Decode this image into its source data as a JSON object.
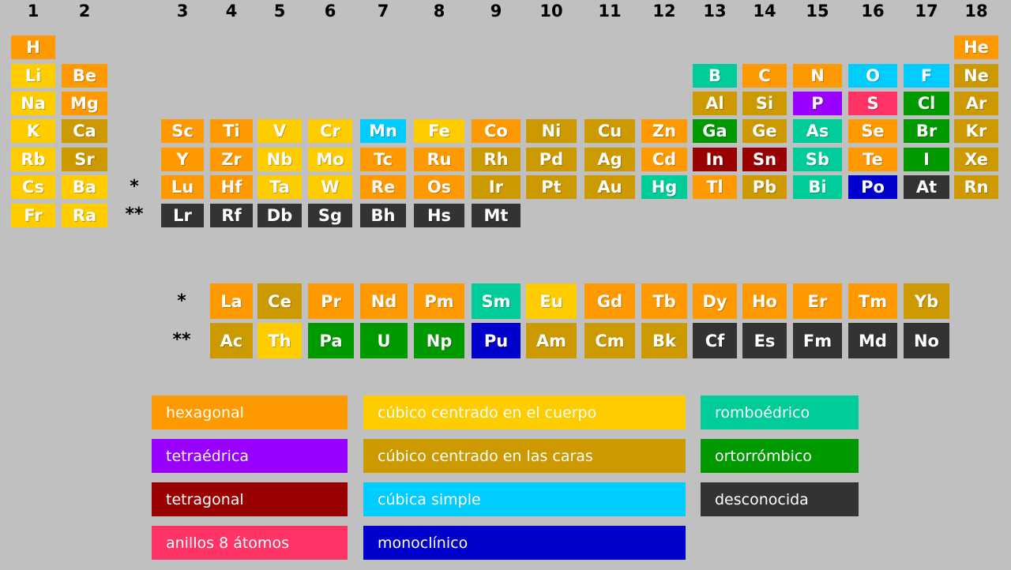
{
  "colors": {
    "hexagonal": "#ff9900",
    "bcc": "#ffcc00",
    "fcc": "#cc9900",
    "rhombo": "#00cc99",
    "ortho": "#009900",
    "tetragonal": "#990000",
    "tetrahedral": "#9900ff",
    "cubic_simple": "#00ccff",
    "mono": "#0000cc",
    "s8": "#ff3366",
    "unknown": "#333333"
  },
  "groups": [
    "1",
    "2",
    "3",
    "4",
    "5",
    "6",
    "7",
    "8",
    "9",
    "10",
    "11",
    "12",
    "13",
    "14",
    "15",
    "16",
    "17",
    "18"
  ],
  "markers": {
    "lanthanide": "*",
    "actinide": "**"
  },
  "elements": [
    {
      "symbol": "H",
      "row": 1,
      "group": 1,
      "structure": "hexagonal"
    },
    {
      "symbol": "He",
      "row": 1,
      "group": 18,
      "structure": "hexagonal"
    },
    {
      "symbol": "Li",
      "row": 2,
      "group": 1,
      "structure": "bcc"
    },
    {
      "symbol": "Be",
      "row": 2,
      "group": 2,
      "structure": "hexagonal"
    },
    {
      "symbol": "B",
      "row": 2,
      "group": 13,
      "structure": "rhombo"
    },
    {
      "symbol": "C",
      "row": 2,
      "group": 14,
      "structure": "hexagonal"
    },
    {
      "symbol": "N",
      "row": 2,
      "group": 15,
      "structure": "hexagonal"
    },
    {
      "symbol": "O",
      "row": 2,
      "group": 16,
      "structure": "cubic_simple"
    },
    {
      "symbol": "F",
      "row": 2,
      "group": 17,
      "structure": "cubic_simple"
    },
    {
      "symbol": "Ne",
      "row": 2,
      "group": 18,
      "structure": "fcc"
    },
    {
      "symbol": "Na",
      "row": 3,
      "group": 1,
      "structure": "bcc"
    },
    {
      "symbol": "Mg",
      "row": 3,
      "group": 2,
      "structure": "hexagonal"
    },
    {
      "symbol": "Al",
      "row": 3,
      "group": 13,
      "structure": "fcc"
    },
    {
      "symbol": "Si",
      "row": 3,
      "group": 14,
      "structure": "fcc"
    },
    {
      "symbol": "P",
      "row": 3,
      "group": 15,
      "structure": "tetrahedral"
    },
    {
      "symbol": "S",
      "row": 3,
      "group": 16,
      "structure": "s8"
    },
    {
      "symbol": "Cl",
      "row": 3,
      "group": 17,
      "structure": "ortho"
    },
    {
      "symbol": "Ar",
      "row": 3,
      "group": 18,
      "structure": "fcc"
    },
    {
      "symbol": "K",
      "row": 4,
      "group": 1,
      "structure": "bcc"
    },
    {
      "symbol": "Ca",
      "row": 4,
      "group": 2,
      "structure": "fcc"
    },
    {
      "symbol": "Sc",
      "row": 4,
      "group": 3,
      "structure": "hexagonal"
    },
    {
      "symbol": "Ti",
      "row": 4,
      "group": 4,
      "structure": "hexagonal"
    },
    {
      "symbol": "V",
      "row": 4,
      "group": 5,
      "structure": "bcc"
    },
    {
      "symbol": "Cr",
      "row": 4,
      "group": 6,
      "structure": "bcc"
    },
    {
      "symbol": "Mn",
      "row": 4,
      "group": 7,
      "structure": "cubic_simple"
    },
    {
      "symbol": "Fe",
      "row": 4,
      "group": 8,
      "structure": "bcc"
    },
    {
      "symbol": "Co",
      "row": 4,
      "group": 9,
      "structure": "hexagonal"
    },
    {
      "symbol": "Ni",
      "row": 4,
      "group": 10,
      "structure": "fcc"
    },
    {
      "symbol": "Cu",
      "row": 4,
      "group": 11,
      "structure": "fcc"
    },
    {
      "symbol": "Zn",
      "row": 4,
      "group": 12,
      "structure": "hexagonal"
    },
    {
      "symbol": "Ga",
      "row": 4,
      "group": 13,
      "structure": "ortho"
    },
    {
      "symbol": "Ge",
      "row": 4,
      "group": 14,
      "structure": "fcc"
    },
    {
      "symbol": "As",
      "row": 4,
      "group": 15,
      "structure": "rhombo"
    },
    {
      "symbol": "Se",
      "row": 4,
      "group": 16,
      "structure": "hexagonal"
    },
    {
      "symbol": "Br",
      "row": 4,
      "group": 17,
      "structure": "ortho"
    },
    {
      "symbol": "Kr",
      "row": 4,
      "group": 18,
      "structure": "fcc"
    },
    {
      "symbol": "Rb",
      "row": 5,
      "group": 1,
      "structure": "bcc"
    },
    {
      "symbol": "Sr",
      "row": 5,
      "group": 2,
      "structure": "fcc"
    },
    {
      "symbol": "Y",
      "row": 5,
      "group": 3,
      "structure": "hexagonal"
    },
    {
      "symbol": "Zr",
      "row": 5,
      "group": 4,
      "structure": "hexagonal"
    },
    {
      "symbol": "Nb",
      "row": 5,
      "group": 5,
      "structure": "bcc"
    },
    {
      "symbol": "Mo",
      "row": 5,
      "group": 6,
      "structure": "bcc"
    },
    {
      "symbol": "Tc",
      "row": 5,
      "group": 7,
      "structure": "hexagonal"
    },
    {
      "symbol": "Ru",
      "row": 5,
      "group": 8,
      "structure": "hexagonal"
    },
    {
      "symbol": "Rh",
      "row": 5,
      "group": 9,
      "structure": "fcc"
    },
    {
      "symbol": "Pd",
      "row": 5,
      "group": 10,
      "structure": "fcc"
    },
    {
      "symbol": "Ag",
      "row": 5,
      "group": 11,
      "structure": "fcc"
    },
    {
      "symbol": "Cd",
      "row": 5,
      "group": 12,
      "structure": "hexagonal"
    },
    {
      "symbol": "In",
      "row": 5,
      "group": 13,
      "structure": "tetragonal"
    },
    {
      "symbol": "Sn",
      "row": 5,
      "group": 14,
      "structure": "tetragonal"
    },
    {
      "symbol": "Sb",
      "row": 5,
      "group": 15,
      "structure": "rhombo"
    },
    {
      "symbol": "Te",
      "row": 5,
      "group": 16,
      "structure": "hexagonal"
    },
    {
      "symbol": "I",
      "row": 5,
      "group": 17,
      "structure": "ortho"
    },
    {
      "symbol": "Xe",
      "row": 5,
      "group": 18,
      "structure": "fcc"
    },
    {
      "symbol": "Cs",
      "row": 6,
      "group": 1,
      "structure": "bcc"
    },
    {
      "symbol": "Ba",
      "row": 6,
      "group": 2,
      "structure": "bcc"
    },
    {
      "symbol": "Lu",
      "row": 6,
      "group": 3,
      "structure": "hexagonal"
    },
    {
      "symbol": "Hf",
      "row": 6,
      "group": 4,
      "structure": "hexagonal"
    },
    {
      "symbol": "Ta",
      "row": 6,
      "group": 5,
      "structure": "bcc"
    },
    {
      "symbol": "W",
      "row": 6,
      "group": 6,
      "structure": "bcc"
    },
    {
      "symbol": "Re",
      "row": 6,
      "group": 7,
      "structure": "hexagonal"
    },
    {
      "symbol": "Os",
      "row": 6,
      "group": 8,
      "structure": "hexagonal"
    },
    {
      "symbol": "Ir",
      "row": 6,
      "group": 9,
      "structure": "fcc"
    },
    {
      "symbol": "Pt",
      "row": 6,
      "group": 10,
      "structure": "fcc"
    },
    {
      "symbol": "Au",
      "row": 6,
      "group": 11,
      "structure": "fcc"
    },
    {
      "symbol": "Hg",
      "row": 6,
      "group": 12,
      "structure": "rhombo"
    },
    {
      "symbol": "Tl",
      "row": 6,
      "group": 13,
      "structure": "hexagonal"
    },
    {
      "symbol": "Pb",
      "row": 6,
      "group": 14,
      "structure": "fcc"
    },
    {
      "symbol": "Bi",
      "row": 6,
      "group": 15,
      "structure": "rhombo"
    },
    {
      "symbol": "Po",
      "row": 6,
      "group": 16,
      "structure": "mono"
    },
    {
      "symbol": "At",
      "row": 6,
      "group": 17,
      "structure": "unknown"
    },
    {
      "symbol": "Rn",
      "row": 6,
      "group": 18,
      "structure": "fcc"
    },
    {
      "symbol": "Fr",
      "row": 7,
      "group": 1,
      "structure": "bcc"
    },
    {
      "symbol": "Ra",
      "row": 7,
      "group": 2,
      "structure": "bcc"
    },
    {
      "symbol": "Lr",
      "row": 7,
      "group": 3,
      "structure": "unknown"
    },
    {
      "symbol": "Rf",
      "row": 7,
      "group": 4,
      "structure": "unknown"
    },
    {
      "symbol": "Db",
      "row": 7,
      "group": 5,
      "structure": "unknown"
    },
    {
      "symbol": "Sg",
      "row": 7,
      "group": 6,
      "structure": "unknown"
    },
    {
      "symbol": "Bh",
      "row": 7,
      "group": 7,
      "structure": "unknown"
    },
    {
      "symbol": "Hs",
      "row": 7,
      "group": 8,
      "structure": "unknown"
    },
    {
      "symbol": "Mt",
      "row": 7,
      "group": 9,
      "structure": "unknown"
    }
  ],
  "lanthanides": [
    {
      "symbol": "La",
      "structure": "hexagonal"
    },
    {
      "symbol": "Ce",
      "structure": "fcc"
    },
    {
      "symbol": "Pr",
      "structure": "hexagonal"
    },
    {
      "symbol": "Nd",
      "structure": "hexagonal"
    },
    {
      "symbol": "Pm",
      "structure": "hexagonal"
    },
    {
      "symbol": "Sm",
      "structure": "rhombo"
    },
    {
      "symbol": "Eu",
      "structure": "bcc"
    },
    {
      "symbol": "Gd",
      "structure": "hexagonal"
    },
    {
      "symbol": "Tb",
      "structure": "hexagonal"
    },
    {
      "symbol": "Dy",
      "structure": "hexagonal"
    },
    {
      "symbol": "Ho",
      "structure": "hexagonal"
    },
    {
      "symbol": "Er",
      "structure": "hexagonal"
    },
    {
      "symbol": "Tm",
      "structure": "hexagonal"
    },
    {
      "symbol": "Yb",
      "structure": "fcc"
    }
  ],
  "actinides": [
    {
      "symbol": "Ac",
      "structure": "fcc"
    },
    {
      "symbol": "Th",
      "structure": "bcc"
    },
    {
      "symbol": "Pa",
      "structure": "ortho"
    },
    {
      "symbol": "U",
      "structure": "ortho"
    },
    {
      "symbol": "Np",
      "structure": "ortho"
    },
    {
      "symbol": "Pu",
      "structure": "mono"
    },
    {
      "symbol": "Am",
      "structure": "fcc"
    },
    {
      "symbol": "Cm",
      "structure": "fcc"
    },
    {
      "symbol": "Bk",
      "structure": "fcc"
    },
    {
      "symbol": "Cf",
      "structure": "unknown"
    },
    {
      "symbol": "Es",
      "structure": "unknown"
    },
    {
      "symbol": "Fm",
      "structure": "unknown"
    },
    {
      "symbol": "Md",
      "structure": "unknown"
    },
    {
      "symbol": "No",
      "structure": "unknown"
    }
  ],
  "legend": [
    {
      "label": "hexagonal",
      "structure": "hexagonal"
    },
    {
      "label": "tetraédrica",
      "structure": "tetrahedral"
    },
    {
      "label": "tetragonal",
      "structure": "tetragonal"
    },
    {
      "label": "anillos 8 átomos",
      "structure": "s8"
    },
    {
      "label": "cúbico centrado en el cuerpo",
      "structure": "bcc"
    },
    {
      "label": "cúbico centrado en las caras",
      "structure": "fcc"
    },
    {
      "label": "cúbica simple",
      "structure": "cubic_simple"
    },
    {
      "label": "monoclínico",
      "structure": "mono"
    },
    {
      "label": "romboédrico",
      "structure": "rhombo"
    },
    {
      "label": "ortorrómbico",
      "structure": "ortho"
    },
    {
      "label": "desconocida",
      "structure": "unknown"
    }
  ]
}
